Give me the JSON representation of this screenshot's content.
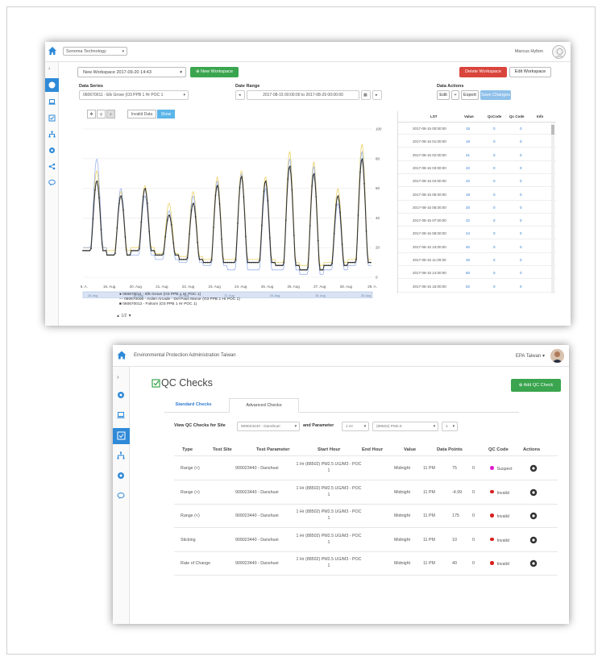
{
  "colors": {
    "primary_blue": "#2f8ad8",
    "green": "#3aa54e",
    "red": "#d9443c",
    "link_blue": "#2f7bd0",
    "suspect": "#e01fd2",
    "invalid": "#d92020"
  },
  "s1": {
    "org_select": "Sonoma Technology",
    "user": "Marcus Hylton",
    "workspace": "New Workspace 2017-09-20 14:43",
    "new_workspace": "New Workspace",
    "delete_workspace": "Delete Workspace",
    "edit_workspace": "Edit Workspace",
    "data_series_label": "Data Series",
    "data_series_value": "060670011 - Elk Grove (O3 PPB 1 Hr POC 1",
    "date_range_label": "Date Range",
    "date_range_value": "2017-08-15 00:00:00 to 2017-08-29 00:00:00",
    "data_actions_label": "Data Actions",
    "edit": "Edit",
    "plus": "+",
    "export": "Export",
    "save_changes": "Save Changes",
    "invalid_data": "Invalid Data",
    "show": "Show",
    "x_ticks": [
      "16. A.",
      "16. Aug",
      "20. Aug",
      "21. Aug",
      "22. Aug",
      "23. Aug",
      "24. Aug",
      "25. Aug",
      "26. Aug",
      "27. Aug",
      "28. Aug",
      "29. A."
    ],
    "y_ticks": [
      "100",
      "80",
      "60",
      "40",
      "20",
      "0"
    ],
    "nav_ticks": [
      "16. Aug",
      "18. Aug",
      "20. Aug",
      "22. Aug",
      "24. Aug",
      "26. Aug",
      "28. Aug"
    ],
    "legend": [
      "060670011 - Elk Grove (O3 PPB 1 Hr POC 1)",
      "060670006 - Arden Arcade - Del Paso Manor (O3 PPB 1 Hr POC 1)",
      "060670012 - Folsom (O3 PPB 1 Hr POC 1)"
    ],
    "pager": "▲ 1/2 ▼",
    "table_headers": [
      "LST",
      "Value",
      "QcCode",
      "Qc Code",
      "Info"
    ],
    "table_rows": [
      {
        "lst": "2017-08-15 00:00:00",
        "value": "15",
        "qccode": "0",
        "qc_code": "0"
      },
      {
        "lst": "2017-08-15 01:00:00",
        "value": "19",
        "qccode": "0",
        "qc_code": "0"
      },
      {
        "lst": "2017-08-15 02:00:00",
        "value": "21",
        "qccode": "0",
        "qc_code": "0"
      },
      {
        "lst": "2017-08-15 03:00:00",
        "value": "22",
        "qccode": "0",
        "qc_code": "0"
      },
      {
        "lst": "2017-08-15 04:00:00",
        "value": "22",
        "qccode": "0",
        "qc_code": "0"
      },
      {
        "lst": "2017-08-15 05:00:00",
        "value": "19",
        "qccode": "0",
        "qc_code": "0"
      },
      {
        "lst": "2017-08-15 06:00:00",
        "value": "20",
        "qccode": "0",
        "qc_code": "0"
      },
      {
        "lst": "2017-08-15 07:00:00",
        "value": "22",
        "qccode": "0",
        "qc_code": "0"
      },
      {
        "lst": "2017-08-15 08:00:00",
        "value": "24",
        "qccode": "0",
        "qc_code": "0"
      },
      {
        "lst": "2017-08-15 10:00:00",
        "value": "40",
        "qccode": "0",
        "qc_code": "0"
      },
      {
        "lst": "2017-08-15 11:00:00",
        "value": "49",
        "qccode": "0",
        "qc_code": "0"
      },
      {
        "lst": "2017-08-15 14:00:00",
        "value": "50",
        "qccode": "0",
        "qc_code": "0"
      },
      {
        "lst": "2017-08-15 15:00:00",
        "value": "52",
        "qccode": "0",
        "qc_code": "0"
      }
    ]
  },
  "s2": {
    "title": "Environmental Protection Administration Taiwan",
    "user": "EPA Taiwan",
    "heading": "QC Checks",
    "add_button": "Add QC Check",
    "tabs": [
      "Standard Checks",
      "Advanced Checks"
    ],
    "filter_site_label": "View QC Checks for Site",
    "site_value": "909023440 - Danshuei",
    "filter_param_label": "and Parameter",
    "param_interval": "1 Hr",
    "param_value": "(88502) PM2.5",
    "param_poc": "1",
    "headers": [
      "Type",
      "Test Site",
      "Test Parameter",
      "Start Hour",
      "End Hour",
      "Value",
      "Data Points",
      "QC Code",
      "Actions"
    ],
    "rows": [
      {
        "type": "Range (<)",
        "site": "909023440 - Danshuei",
        "param": "1 Hr (88502) PM2.5 UG/M3 - POC 1",
        "start": "Midnight",
        "end": "11 PM",
        "value": "75",
        "points": "0",
        "code": "Suspect",
        "status": "suspect"
      },
      {
        "type": "Range (>)",
        "site": "909023440 - Danshuei",
        "param": "1 Hr (88502) PM2.5 UG/M3 - POC 1",
        "start": "Midnight",
        "end": "11 PM",
        "value": "-4.99",
        "points": "0",
        "code": "Invalid",
        "status": "invalid"
      },
      {
        "type": "Range (<)",
        "site": "909023440 - Danshuei",
        "param": "1 Hr (88502) PM2.5 UG/M3 - POC 1",
        "start": "Midnight",
        "end": "11 PM",
        "value": "175",
        "points": "0",
        "code": "Invalid",
        "status": "invalid"
      },
      {
        "type": "Sticking",
        "site": "909023440 - Danshuei",
        "param": "1 Hr (88502) PM2.5 UG/M3 - POC 1",
        "start": "Midnight",
        "end": "11 PM",
        "value": "10",
        "points": "0",
        "code": "Invalid",
        "status": "invalid"
      },
      {
        "type": "Rate of Change",
        "site": "909023440 - Danshuei",
        "param": "1 Hr (88502) PM2.5 UG/M3 - POC 1",
        "start": "Midnight",
        "end": "11 PM",
        "value": "40",
        "points": "0",
        "code": "Invalid",
        "status": "invalid"
      }
    ]
  },
  "chart_data": {
    "type": "line",
    "x": [
      "15. Aug",
      "16. Aug",
      "20. Aug",
      "21. Aug",
      "22. Aug",
      "23. Aug",
      "24. Aug",
      "25. Aug",
      "26. Aug",
      "27. Aug",
      "28. Aug",
      "29. Aug"
    ],
    "ylim": [
      0,
      100
    ],
    "series": [
      {
        "name": "060670011 - Elk Grove (O3 PPB 1 Hr POC 1)",
        "color": "#333333",
        "daily_peaks": [
          65,
          55,
          60,
          42,
          50,
          62,
          68,
          65,
          75,
          70,
          55,
          80
        ],
        "daily_lows": [
          18,
          15,
          18,
          15,
          12,
          10,
          10,
          10,
          8,
          5,
          8,
          10
        ]
      },
      {
        "name": "060670006 - Arden Arcade - Del Paso Manor (O3 PPB 1 Hr POC 1)",
        "color": "#8aa6e8",
        "daily_peaks": [
          80,
          60,
          55,
          45,
          55,
          65,
          70,
          60,
          80,
          75,
          50,
          85
        ],
        "daily_lows": [
          20,
          15,
          15,
          12,
          10,
          8,
          5,
          5,
          5,
          2,
          5,
          8
        ]
      },
      {
        "name": "060670012 - Folsom (O3 PPB 1 Hr POC 1)",
        "color": "#e8c84a",
        "daily_peaks": [
          72,
          58,
          62,
          50,
          58,
          68,
          72,
          68,
          85,
          78,
          60,
          90
        ],
        "daily_lows": [
          20,
          18,
          20,
          16,
          14,
          12,
          12,
          12,
          10,
          8,
          10,
          12
        ]
      }
    ]
  }
}
